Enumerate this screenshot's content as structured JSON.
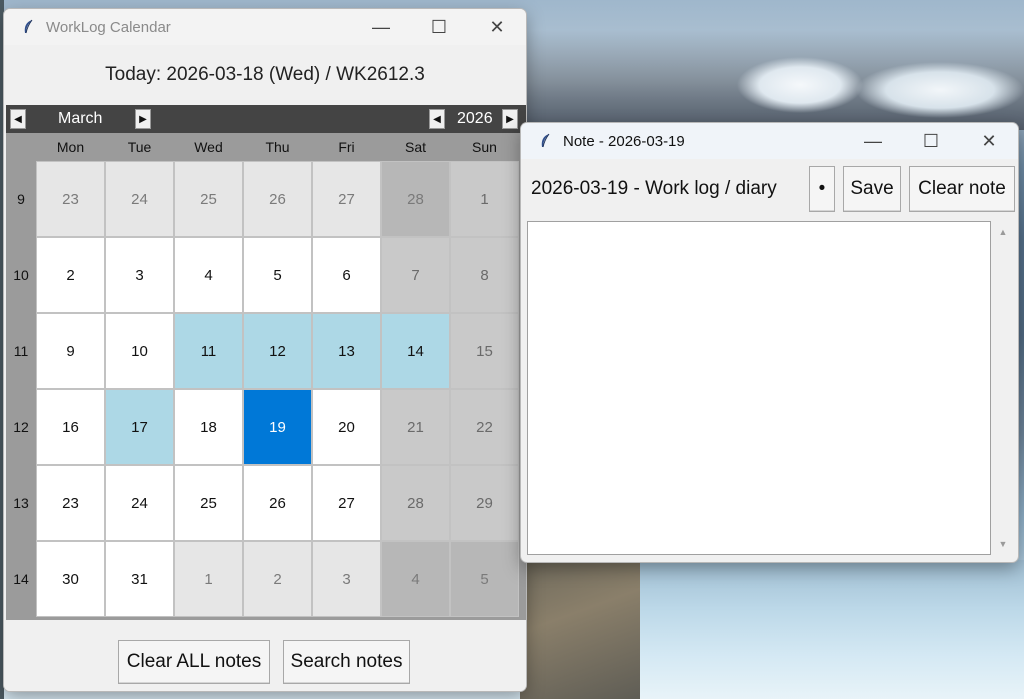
{
  "calendar_window": {
    "title": "WorkLog Calendar",
    "today": "Today: 2026-03-18 (Wed) / WK2612.3",
    "month": "March",
    "year": "2026",
    "weekdays": [
      "Mon",
      "Tue",
      "Wed",
      "Thu",
      "Fri",
      "Sat",
      "Sun"
    ],
    "weeks": [
      {
        "wk": "9",
        "days": [
          "23",
          "24",
          "25",
          "26",
          "27",
          "28",
          "1"
        ]
      },
      {
        "wk": "10",
        "days": [
          "2",
          "3",
          "4",
          "5",
          "6",
          "7",
          "8"
        ]
      },
      {
        "wk": "11",
        "days": [
          "9",
          "10",
          "11",
          "12",
          "13",
          "14",
          "15"
        ]
      },
      {
        "wk": "12",
        "days": [
          "16",
          "17",
          "18",
          "19",
          "20",
          "21",
          "22"
        ]
      },
      {
        "wk": "13",
        "days": [
          "23",
          "24",
          "25",
          "26",
          "27",
          "28",
          "29"
        ]
      },
      {
        "wk": "14",
        "days": [
          "30",
          "31",
          "1",
          "2",
          "3",
          "4",
          "5"
        ]
      }
    ],
    "buttons": {
      "clear_all": "Clear ALL notes",
      "search": "Search notes"
    }
  },
  "note_window": {
    "title": "Note - 2026-03-19",
    "label": "2026-03-19 - Work log / diary",
    "bullet": "•",
    "save": "Save",
    "clear": "Clear note",
    "content": ""
  },
  "colors": {
    "accent": "#0078d7",
    "note_highlight": "#add8e6"
  }
}
